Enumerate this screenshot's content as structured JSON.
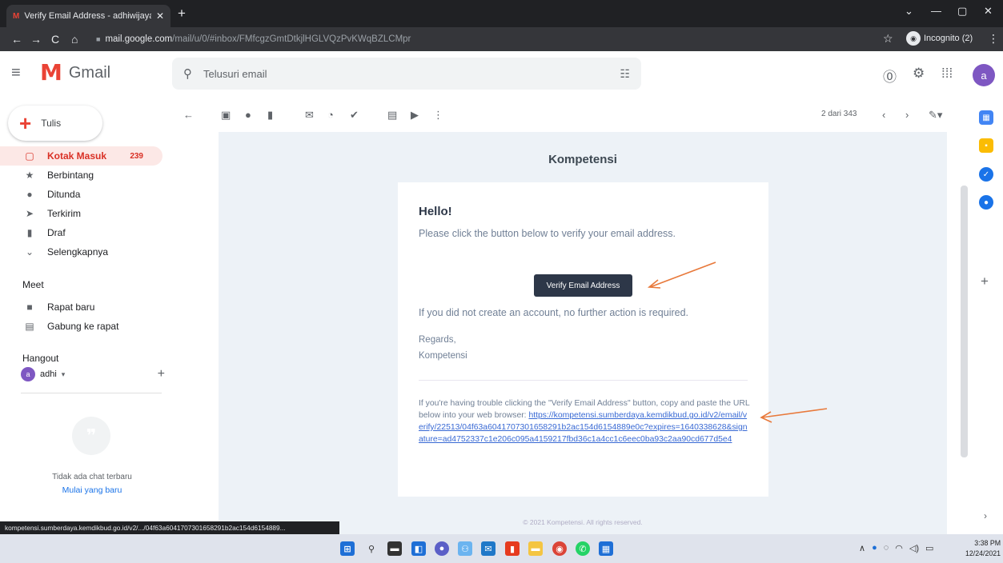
{
  "browser": {
    "tab_title": "Verify Email Address - adhiwijaya",
    "url_host": "mail.google.com",
    "url_path": "/mail/u/0/#inbox/FMfcgzGmtDtkjlHGLVQzPvKWqBZLCMpr",
    "incognito_label": "Incognito (2)"
  },
  "gmail": {
    "app_name": "Gmail",
    "search_placeholder": "Telusuri email",
    "avatar_letter": "a",
    "compose_label": "Tulis",
    "nav": [
      {
        "label": "Kotak Masuk",
        "count": "239",
        "icon": "inbox-icon",
        "glyph": "▢"
      },
      {
        "label": "Berbintang",
        "icon": "star-icon",
        "glyph": "★"
      },
      {
        "label": "Ditunda",
        "icon": "clock-icon",
        "glyph": "●"
      },
      {
        "label": "Terkirim",
        "icon": "send-icon",
        "glyph": "➤"
      },
      {
        "label": "Draf",
        "icon": "draft-icon",
        "glyph": "▮"
      },
      {
        "label": "Selengkapnya",
        "icon": "chevron-down-icon",
        "glyph": "⌄"
      }
    ],
    "meet": {
      "title": "Meet",
      "items": [
        {
          "label": "Rapat baru",
          "icon": "video-icon",
          "glyph": "■"
        },
        {
          "label": "Gabung ke rapat",
          "icon": "keyboard-icon",
          "glyph": "▤"
        }
      ]
    },
    "hangout": {
      "title": "Hangout",
      "user": "adhi",
      "user_letter": "a",
      "no_chat": "Tidak ada chat terbaru",
      "start_new": "Mulai yang baru"
    },
    "pager": "2 dari 343"
  },
  "email": {
    "brand": "Kompetensi",
    "greeting": "Hello!",
    "intro": "Please click the button below to verify your email address.",
    "button": "Verify Email Address",
    "outro": "If you did not create an account, no further action is required.",
    "regards": "Regards,",
    "signature": "Kompetensi",
    "trouble_text": "If you're having trouble clicking the \"Verify Email Address\" button, copy and paste the URL below into your web browser: ",
    "verify_url": "https://kompetensi.sumberdaya.kemdikbud.go.id/v2/email/verify/22513/04f63a6041707301658291b2ac154d6154889e0c?expires=1640338628&signature=ad4752337c1e206c095a4159217fbd36c1a4cc1c6eec0ba93c2aa90cd677d5e4",
    "footer": "© 2021 Kompetensi. All rights reserved."
  },
  "status_url": "kompetensi.sumberdaya.kemdikbud.go.id/v2/.../04f63a6041707301658291b2ac154d6154889...",
  "taskbar": {
    "time": "3:38 PM",
    "date": "12/24/2021"
  },
  "colors": {
    "arrow": "#e8793b",
    "active_nav": "#d93025",
    "button_bg": "#2d3748"
  }
}
